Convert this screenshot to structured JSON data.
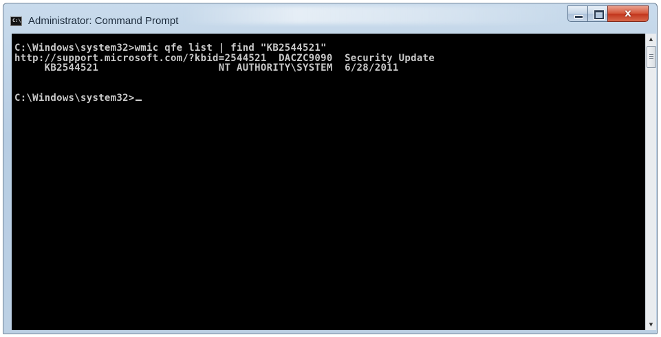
{
  "window": {
    "title": "Administrator: Command Prompt",
    "icon": "cmd-icon",
    "icon_text": "C:\\"
  },
  "controls": {
    "minimize": "minimize-icon",
    "maximize": "maximize-icon",
    "close": "close-icon",
    "close_glyph": "x"
  },
  "console": {
    "lines": [
      "C:\\Windows\\system32>wmic qfe list | find \"KB2544521\"",
      "http://support.microsoft.com/?kbid=2544521  DACZC9090  Security Update",
      "     KB2544521                    NT AUTHORITY\\SYSTEM  6/28/2011",
      "",
      "",
      "C:\\Windows\\system32>"
    ]
  },
  "colors": {
    "console_bg": "#000000",
    "console_text": "#c9c9c9",
    "close_button": "#c2351c"
  }
}
